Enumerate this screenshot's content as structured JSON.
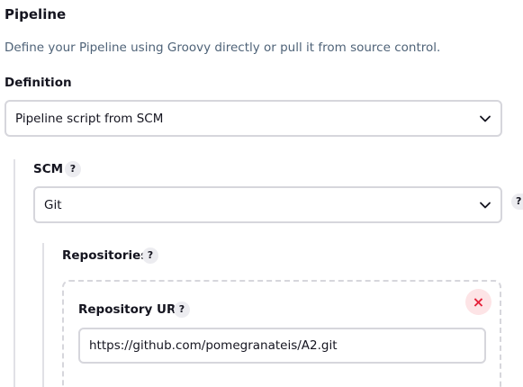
{
  "section": {
    "title": "Pipeline",
    "description": "Define your Pipeline using Groovy directly or pull it from source control."
  },
  "definition": {
    "label": "Definition",
    "selected": "Pipeline script from SCM"
  },
  "scm": {
    "label": "SCM",
    "help": "?",
    "selected": "Git",
    "cut_help": "?"
  },
  "repositories": {
    "label": "Repositories",
    "help": "?",
    "repository_url": {
      "label": "Repository URL",
      "help": "?",
      "value": "https://github.com/pomegranateis/A2.git"
    },
    "delete_icon": "×"
  },
  "icons": {
    "chevron": "chevron-down-icon",
    "delete": "close-icon",
    "help": "help-icon"
  },
  "colors": {
    "text": "#14141f",
    "description": "#4f6378",
    "border": "#d6d6dc",
    "help_bg": "#ececf0",
    "delete_bg": "#fde4e6",
    "delete_fg": "#e5213a"
  }
}
